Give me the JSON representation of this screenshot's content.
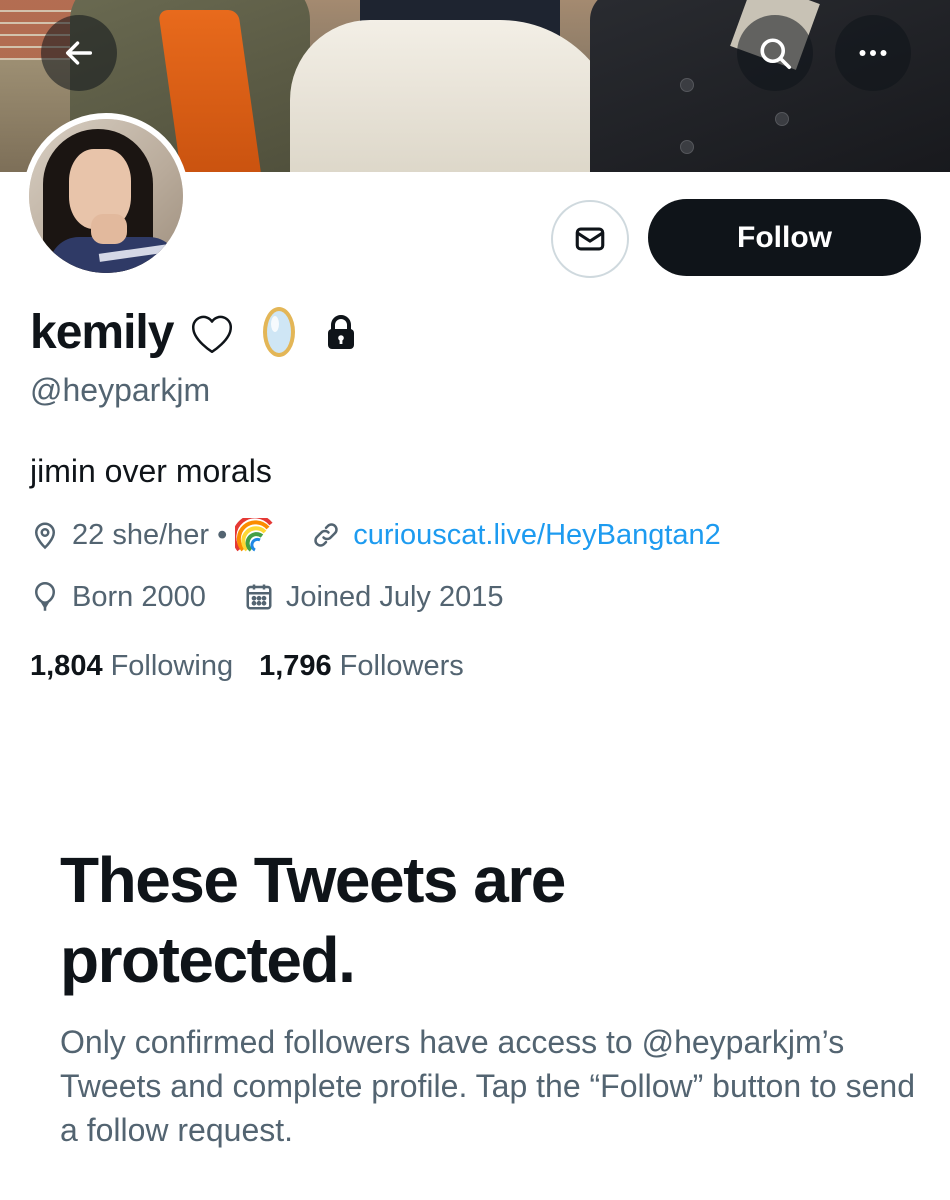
{
  "profile": {
    "display_name": "kemily",
    "handle": "@heyparkjm",
    "bio": "jimin over morals",
    "location": "22 she/her •",
    "website": "curiouscat.live/HeyBangtan2",
    "birth": "Born 2000",
    "joined": "Joined July 2015",
    "following_count": "1,804",
    "following_label": "Following",
    "followers_count": "1,796",
    "followers_label": "Followers"
  },
  "actions": {
    "follow_label": "Follow"
  },
  "protected": {
    "title": "These Tweets are protected.",
    "body": "Only confirmed followers have access to @heyparkjm’s Tweets and complete profile. Tap the “Follow” button to send a follow request."
  },
  "icons": {
    "back": "back-arrow-icon",
    "search": "search-icon",
    "more": "more-icon",
    "message": "mail-icon",
    "heart": "heart-icon",
    "mirror": "mirror-emoji-icon",
    "lock": "lock-icon",
    "location": "location-pin-icon",
    "rainbow": "rainbow-emoji-icon",
    "link": "link-icon",
    "birthday": "balloon-icon",
    "calendar": "calendar-icon"
  },
  "colors": {
    "accent": "#1d9bf0",
    "primary_text": "#0f1419",
    "secondary_text": "#536471",
    "follow_button": "#0f1419"
  }
}
